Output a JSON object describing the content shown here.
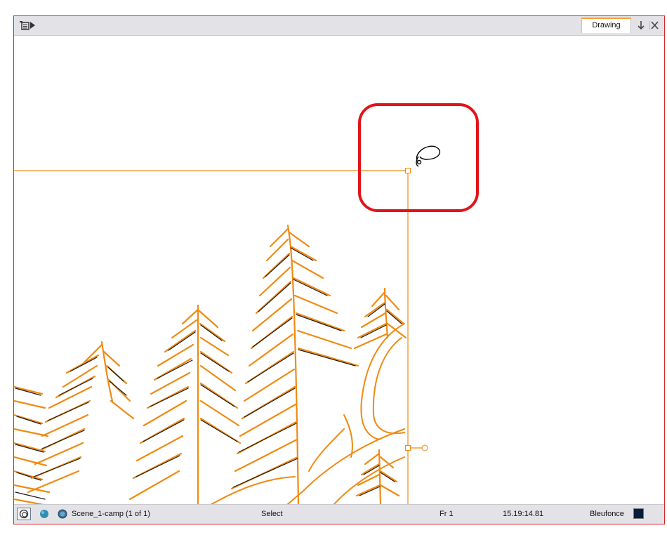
{
  "toolbar": {
    "menu_icon": "view-menu-icon",
    "tab_label": "Drawing",
    "pin_icon": "pin-icon",
    "close_icon": "close-icon"
  },
  "canvas": {
    "highlight_color": "#e0141a",
    "stroke_color": "#f08a12",
    "cursor_icon": "lasso-cursor-icon"
  },
  "status": {
    "scene": "Scene_1-camp (1 of 1)",
    "tool": "Select",
    "frame": "Fr 1",
    "timecode": "15.19:14.81",
    "color_name": "Bleufonce",
    "color_swatch": "#0b1b3d"
  }
}
